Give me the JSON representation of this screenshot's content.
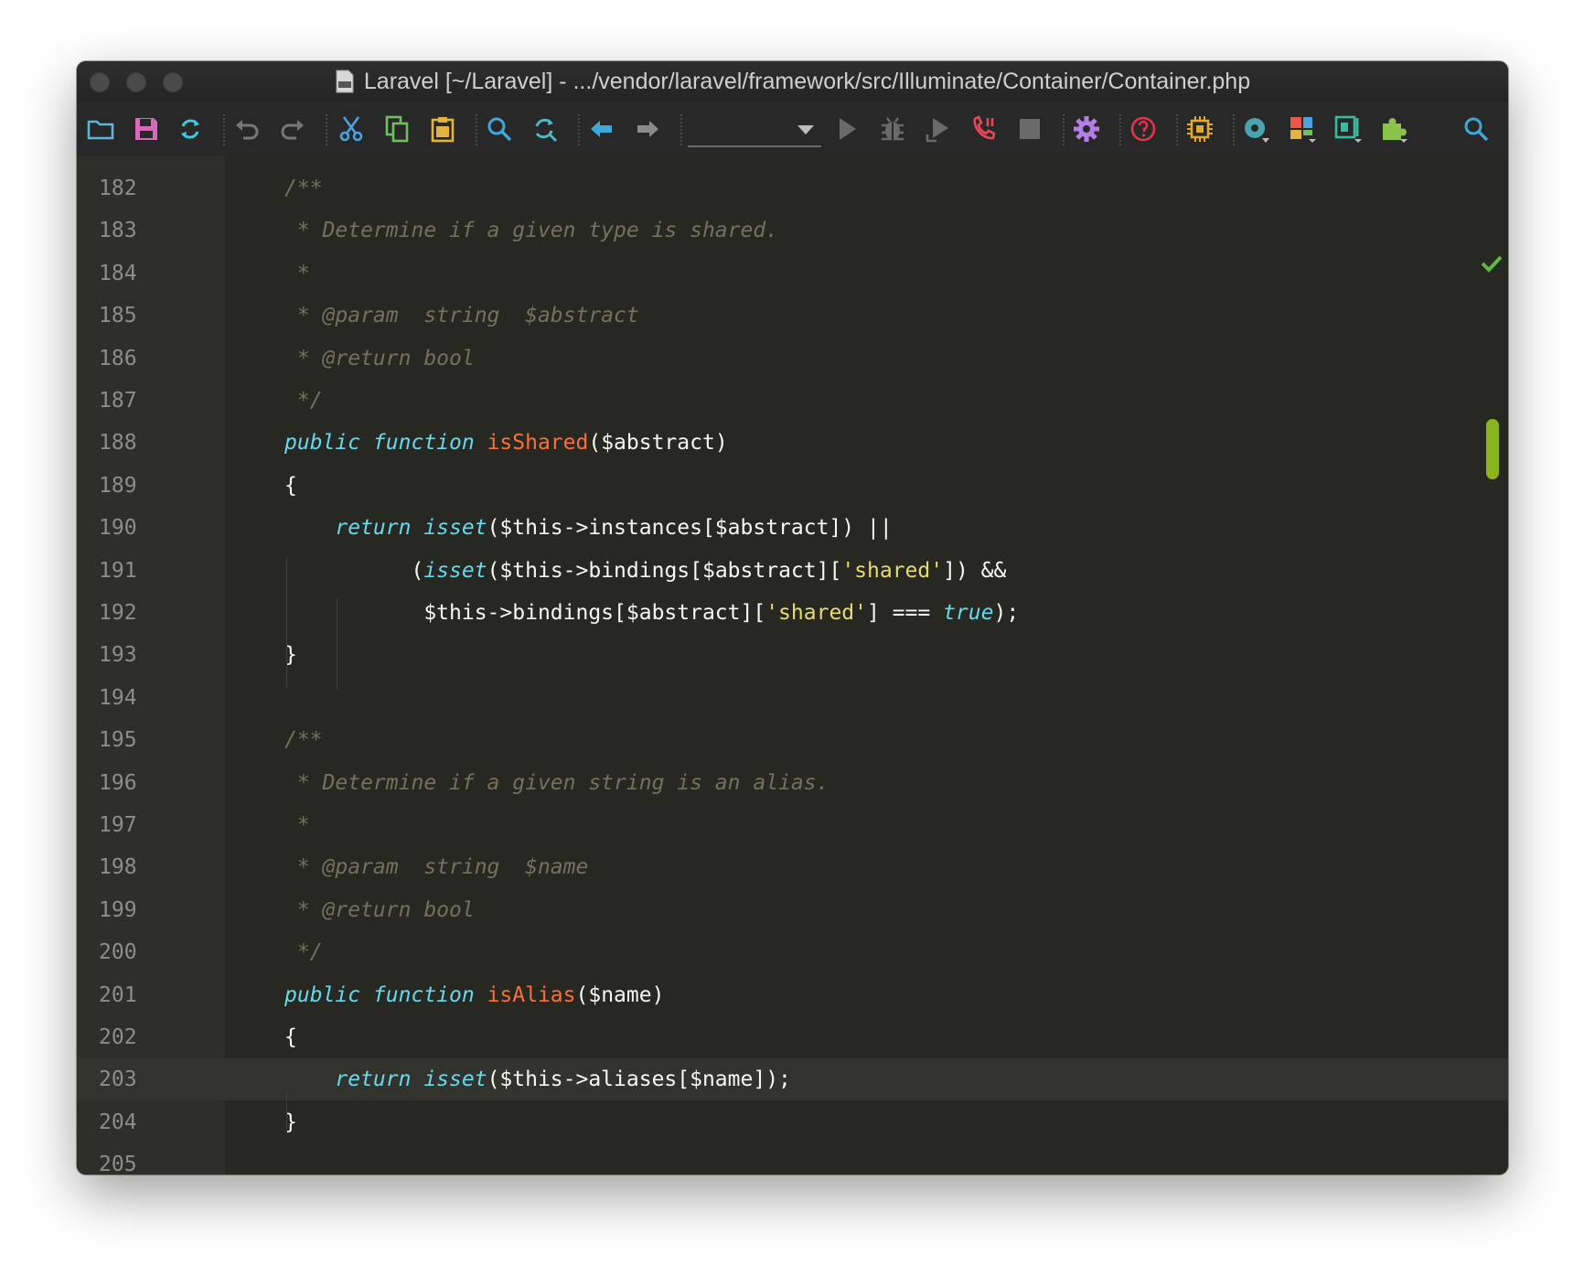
{
  "window": {
    "title": "Laravel [~/Laravel] - .../vendor/laravel/framework/src/Illuminate/Container/Container.php"
  },
  "toolbar": {
    "buttons": [
      {
        "name": "open-folder-icon",
        "color": "#5fb4d9"
      },
      {
        "name": "save-icon",
        "color": "#d46ab8"
      },
      {
        "name": "sync-icon",
        "color": "#3ec9e0"
      },
      {
        "name": "undo-icon",
        "color": "#777777"
      },
      {
        "name": "redo-icon",
        "color": "#777777"
      },
      {
        "name": "cut-icon",
        "color": "#4aa3df"
      },
      {
        "name": "copy-icon",
        "color": "#6fbf5f"
      },
      {
        "name": "paste-icon",
        "color": "#e3b341"
      },
      {
        "name": "find-icon",
        "color": "#3ea9d9"
      },
      {
        "name": "replace-icon",
        "color": "#4fb8c9"
      },
      {
        "name": "back-icon",
        "color": "#3ea9d9"
      },
      {
        "name": "forward-icon",
        "color": "#8a8a8a"
      },
      {
        "name": "run-icon",
        "color": "#6a6a6a"
      },
      {
        "name": "debug-icon",
        "color": "#6a6a6a"
      },
      {
        "name": "run-coverage-icon",
        "color": "#6a6a6a"
      },
      {
        "name": "phone-listen-icon",
        "color": "#e8475a"
      },
      {
        "name": "stop-icon",
        "color": "#6a6a6a"
      },
      {
        "name": "settings-icon",
        "color": "#b57ee6"
      },
      {
        "name": "help-icon",
        "color": "#e0364f"
      },
      {
        "name": "cpu-icon",
        "color": "#e3a72e"
      },
      {
        "name": "database-icon",
        "color": "#4aa3b0"
      },
      {
        "name": "layout-icon",
        "color": "#e8574a"
      },
      {
        "name": "code-structure-icon",
        "color": "#3ab9a0"
      },
      {
        "name": "plugins-icon",
        "color": "#8bc34a"
      },
      {
        "name": "search-everywhere-icon",
        "color": "#3ea9d9"
      }
    ],
    "run_config": ""
  },
  "editor": {
    "current_line": "203",
    "lines": [
      {
        "n": "182",
        "tokens": [
          {
            "t": "/**",
            "c": "cm"
          }
        ]
      },
      {
        "n": "183",
        "tokens": [
          {
            "t": " * Determine if a given type is shared.",
            "c": "cm"
          }
        ]
      },
      {
        "n": "184",
        "tokens": [
          {
            "t": " *",
            "c": "cm"
          }
        ]
      },
      {
        "n": "185",
        "tokens": [
          {
            "t": " * @param  string  $abstract",
            "c": "cm"
          }
        ]
      },
      {
        "n": "186",
        "tokens": [
          {
            "t": " * @return bool",
            "c": "cm"
          }
        ]
      },
      {
        "n": "187",
        "tokens": [
          {
            "t": " */",
            "c": "cm"
          }
        ]
      },
      {
        "n": "188",
        "tokens": [
          {
            "t": "public function ",
            "c": "kw"
          },
          {
            "t": "isShared",
            "c": "fn"
          },
          {
            "t": "($abstract)",
            "c": ""
          }
        ]
      },
      {
        "n": "189",
        "tokens": [
          {
            "t": "{",
            "c": ""
          }
        ]
      },
      {
        "n": "190",
        "tokens": [
          {
            "t": "    ",
            "c": ""
          },
          {
            "t": "return isset",
            "c": "kw"
          },
          {
            "t": "($this->instances[$abstract]) ||",
            "c": ""
          }
        ]
      },
      {
        "n": "191",
        "tokens": [
          {
            "t": "          (",
            "c": ""
          },
          {
            "t": "isset",
            "c": "kw"
          },
          {
            "t": "($this->bindings[$abstract][",
            "c": ""
          },
          {
            "t": "'shared'",
            "c": "st"
          },
          {
            "t": "]) &&",
            "c": ""
          }
        ]
      },
      {
        "n": "192",
        "tokens": [
          {
            "t": "           $this->bindings[$abstract][",
            "c": ""
          },
          {
            "t": "'shared'",
            "c": "st"
          },
          {
            "t": "] === ",
            "c": ""
          },
          {
            "t": "true",
            "c": "kw"
          },
          {
            "t": ");",
            "c": ""
          }
        ]
      },
      {
        "n": "193",
        "tokens": [
          {
            "t": "}",
            "c": ""
          }
        ]
      },
      {
        "n": "194",
        "tokens": []
      },
      {
        "n": "195",
        "tokens": [
          {
            "t": "/**",
            "c": "cm"
          }
        ]
      },
      {
        "n": "196",
        "tokens": [
          {
            "t": " * Determine if a given string is an alias.",
            "c": "cm"
          }
        ]
      },
      {
        "n": "197",
        "tokens": [
          {
            "t": " *",
            "c": "cm"
          }
        ]
      },
      {
        "n": "198",
        "tokens": [
          {
            "t": " * @param  string  $name",
            "c": "cm"
          }
        ]
      },
      {
        "n": "199",
        "tokens": [
          {
            "t": " * @return bool",
            "c": "cm"
          }
        ]
      },
      {
        "n": "200",
        "tokens": [
          {
            "t": " */",
            "c": "cm"
          }
        ]
      },
      {
        "n": "201",
        "tokens": [
          {
            "t": "public function ",
            "c": "kw"
          },
          {
            "t": "isAlias",
            "c": "fn"
          },
          {
            "t": "($name)",
            "c": ""
          }
        ]
      },
      {
        "n": "202",
        "tokens": [
          {
            "t": "{",
            "c": ""
          }
        ]
      },
      {
        "n": "203",
        "tokens": [
          {
            "t": "    ",
            "c": ""
          },
          {
            "t": "return isset",
            "c": "kw"
          },
          {
            "t": "($this->aliases[$name]);",
            "c": ""
          }
        ]
      },
      {
        "n": "204",
        "tokens": [
          {
            "t": "}",
            "c": ""
          }
        ]
      },
      {
        "n": "205",
        "tokens": []
      }
    ]
  },
  "status": {
    "inspection": "check-icon"
  }
}
